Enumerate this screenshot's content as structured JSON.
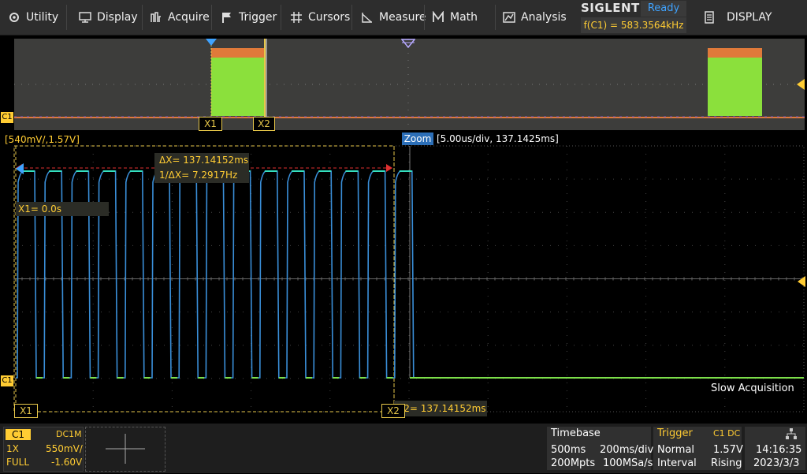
{
  "menu": {
    "utility": "Utility",
    "display": "Display",
    "acquire": "Acquire",
    "trigger": "Trigger",
    "cursors": "Cursors",
    "measure": "Measure",
    "math": "Math",
    "analysis": "Analysis",
    "display_right": "DISPLAY"
  },
  "brand": {
    "logo": "SIGLENT",
    "status": "Ready",
    "freq": "f(C1) = 583.3564kHz"
  },
  "overview": {
    "x1": "X1",
    "x2": "X2",
    "ch": "C1"
  },
  "zoom": {
    "scale_label": "[540mV/,1.57V]",
    "zoom_tag": "Zoom",
    "zoom_info": "[5.00us/div, 137.1425ms]",
    "delta_x": "ΔX= 137.14152ms",
    "inv_delta_x": "1/ΔX= 7.2917Hz",
    "x1_value": "X1= 0.0s",
    "x2_value": "X2= 137.14152ms",
    "x1": "X1",
    "x2": "X2",
    "ch": "C1",
    "slow": "Slow Acquisition"
  },
  "channel": {
    "name": "C1",
    "coupling": "DC1M",
    "probe": "1X",
    "scale": "550mV/",
    "bw": "FULL",
    "offset": "-1.60V"
  },
  "timebase": {
    "title": "Timebase",
    "delay": "500ms",
    "scale": "200ms/div",
    "memory": "200Mpts",
    "rate": "100MSa/s"
  },
  "trigger": {
    "title": "Trigger",
    "source": "C1 DC",
    "mode": "Normal",
    "level": "1.57V",
    "type": "Interval",
    "slope": "Rising"
  },
  "clock": {
    "time": "14:16:35",
    "date": "2023/3/3"
  },
  "colors": {
    "accent": "#ffcc33",
    "trace": "#3a8fd9",
    "trace_top": "#35e0c0",
    "ground": "#7ce04a"
  }
}
